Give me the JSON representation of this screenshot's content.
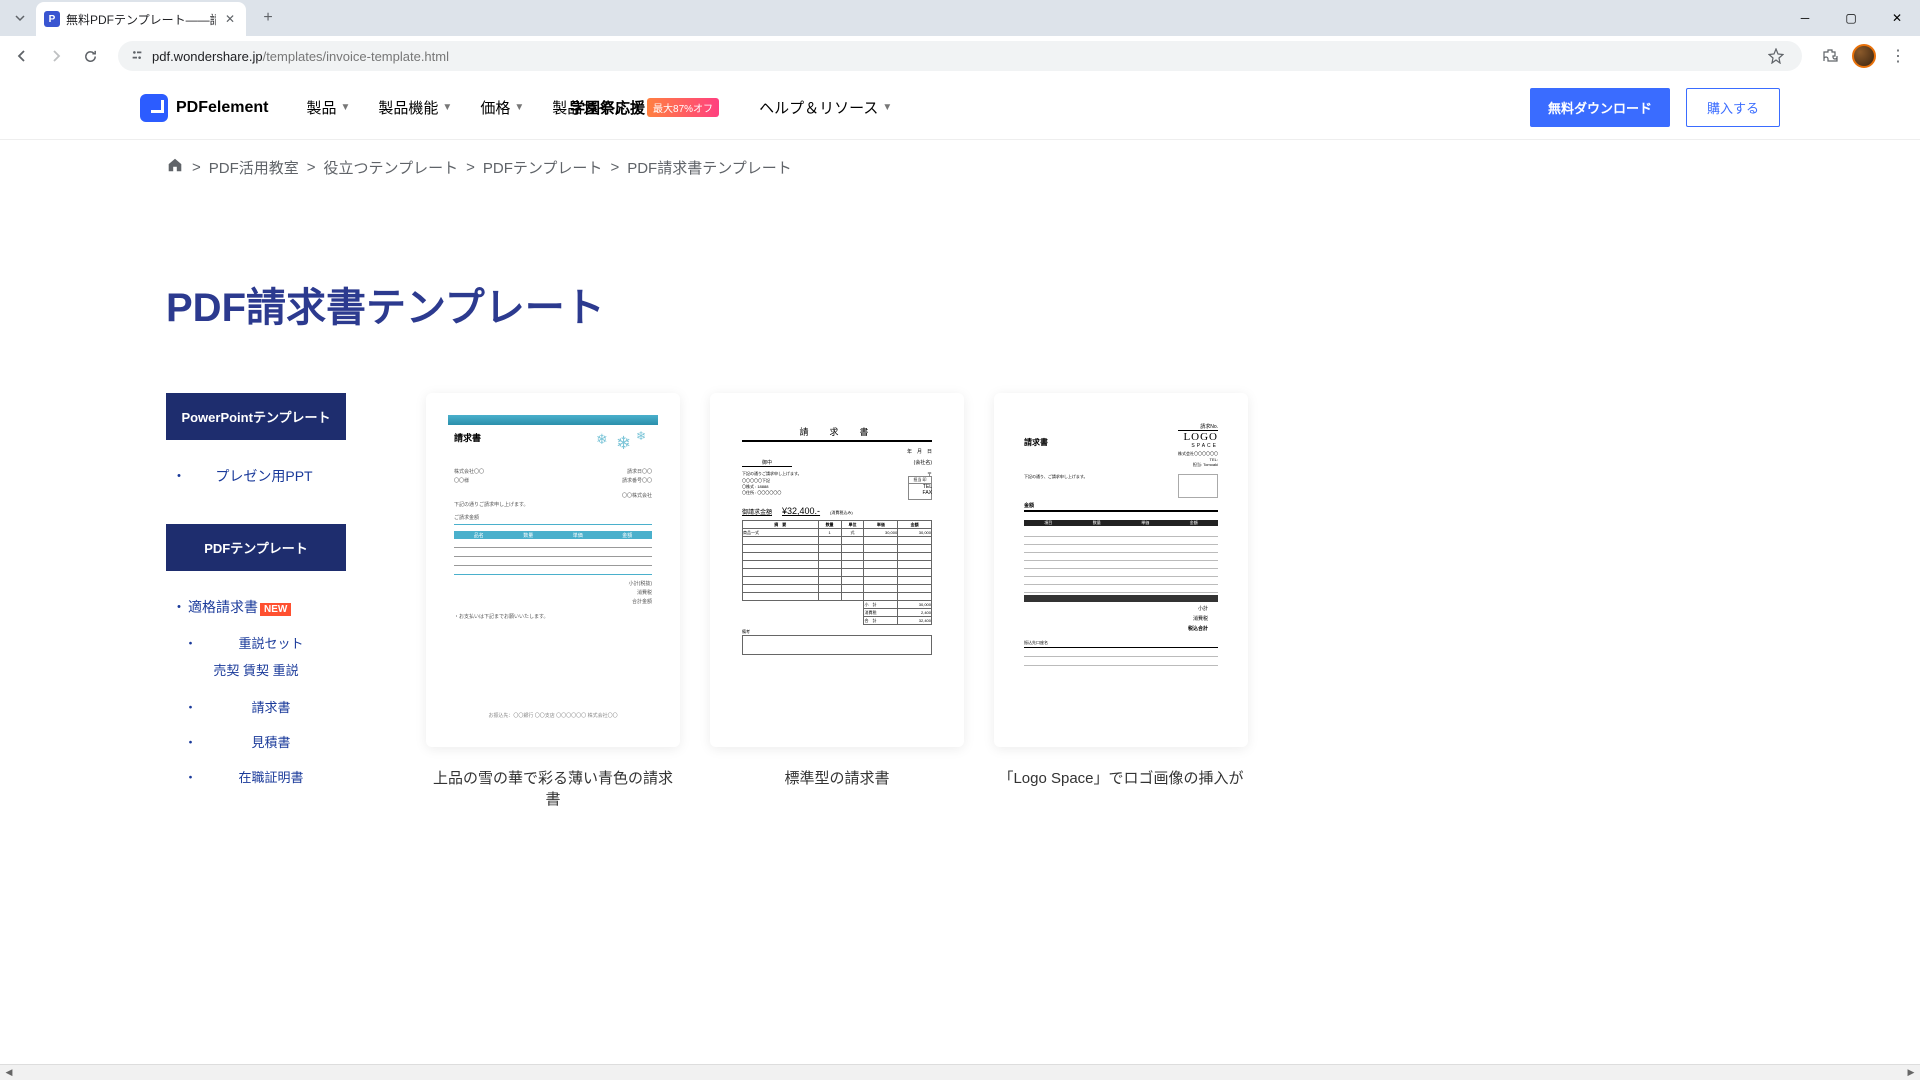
{
  "browser": {
    "tab_title": "無料PDFテンプレート――請求書テ",
    "url_domain": "pdf.wondershare.jp",
    "url_path": "/templates/invoice-template.html"
  },
  "header": {
    "logo_text": "PDFelement",
    "nav": [
      "製品",
      "製品機能",
      "価格",
      "製品ガイド",
      "ヘルプ＆リソース"
    ],
    "promo_text": "学園祭応援",
    "promo_badge": "最大87%オフ",
    "btn_download": "無料ダウンロード",
    "btn_buy": "購入する"
  },
  "breadcrumb": {
    "items": [
      "PDF活用教室",
      "役立つテンプレート",
      "PDFテンプレート",
      "PDF請求書テンプレート"
    ]
  },
  "page_title": "PDF請求書テンプレート",
  "sidebar": {
    "section1_title": "PowerPointテンプレート",
    "section1_items": [
      "プレゼン用PPT"
    ],
    "section2_title": "PDFテンプレート",
    "section2_items": [
      {
        "label": "適格請求書",
        "new": true
      },
      {
        "label": "重説セット",
        "sub_label": "売契 賃契 重説"
      },
      {
        "label": "請求書"
      },
      {
        "label": "見積書"
      },
      {
        "label": "在職証明書"
      }
    ]
  },
  "templates": [
    {
      "caption": "上品の雪の華で彩る薄い青色の請求書",
      "doc_title": "請求書"
    },
    {
      "caption": "標準型の請求書",
      "doc_title": "請　求　書",
      "total_label": "御請求金額",
      "total_value": "¥32,400.-"
    },
    {
      "caption": "「Logo Space」でロゴ画像の挿入が",
      "doc_title": "請求書",
      "logo_text": "LOGO",
      "logo_sub": "SPACE"
    }
  ]
}
